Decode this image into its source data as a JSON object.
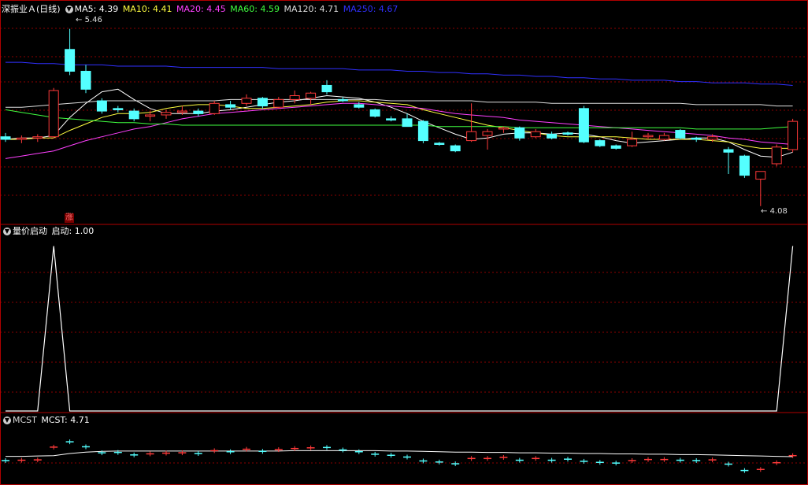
{
  "price_panel": {
    "name": "深振业Ａ(日线)",
    "ma": [
      {
        "label": "MA5: 4.39",
        "color": "#ffffff"
      },
      {
        "label": "MA10: 4.41",
        "color": "#ffff40"
      },
      {
        "label": "MA20: 4.45",
        "color": "#ff40ff"
      },
      {
        "label": "MA60: 4.59",
        "color": "#40ff40"
      },
      {
        "label": "MA120: 4.71",
        "color": "#dddddd"
      },
      {
        "label": "MA250: 4.67",
        "color": "#3030ff"
      }
    ],
    "high_label": "5.46",
    "low_label": "4.08",
    "zhang_label": "涨"
  },
  "indicator_panel": {
    "title": "量价启动",
    "value_label": "启动: 1.00"
  },
  "mcst_panel": {
    "title": "MCST",
    "value_label": "MCST: 4.71"
  },
  "colors": {
    "up": "#ff3a3a",
    "down": "#54ffff",
    "grid": "#8b0000",
    "border": "#b00000"
  },
  "chart_data": {
    "type": "candlestick",
    "ylim": [
      3.95,
      5.55
    ],
    "candles": [
      [
        4.62,
        4.65,
        4.58,
        4.6
      ],
      [
        4.6,
        4.63,
        4.57,
        4.61
      ],
      [
        4.61,
        4.64,
        4.58,
        4.62
      ],
      [
        4.62,
        5.0,
        4.61,
        4.98
      ],
      [
        5.3,
        5.46,
        5.1,
        5.13
      ],
      [
        5.13,
        5.18,
        4.96,
        4.99
      ],
      [
        4.9,
        4.92,
        4.8,
        4.82
      ],
      [
        4.84,
        4.86,
        4.81,
        4.83
      ],
      [
        4.82,
        4.84,
        4.74,
        4.76
      ],
      [
        4.78,
        4.82,
        4.74,
        4.79
      ],
      [
        4.79,
        4.83,
        4.76,
        4.81
      ],
      [
        4.81,
        4.86,
        4.79,
        4.82
      ],
      [
        4.82,
        4.84,
        4.78,
        4.8
      ],
      [
        4.8,
        4.9,
        4.79,
        4.88
      ],
      [
        4.87,
        4.9,
        4.83,
        4.85
      ],
      [
        4.88,
        4.95,
        4.86,
        4.92
      ],
      [
        4.92,
        4.93,
        4.84,
        4.86
      ],
      [
        4.85,
        4.93,
        4.84,
        4.91
      ],
      [
        4.91,
        4.98,
        4.88,
        4.94
      ],
      [
        4.92,
        4.97,
        4.87,
        4.96
      ],
      [
        5.02,
        5.06,
        4.95,
        4.97
      ],
      [
        4.91,
        4.93,
        4.89,
        4.9
      ],
      [
        4.87,
        4.89,
        4.84,
        4.85
      ],
      [
        4.83,
        4.84,
        4.77,
        4.78
      ],
      [
        4.76,
        4.78,
        4.74,
        4.75
      ],
      [
        4.76,
        4.8,
        4.74,
        4.7
      ],
      [
        4.74,
        4.75,
        4.57,
        4.59
      ],
      [
        4.57,
        4.58,
        4.55,
        4.56
      ],
      [
        4.55,
        4.56,
        4.5,
        4.51
      ],
      [
        4.59,
        4.88,
        4.58,
        4.66
      ],
      [
        4.63,
        4.68,
        4.52,
        4.66
      ],
      [
        4.68,
        4.7,
        4.65,
        4.69
      ],
      [
        4.69,
        4.7,
        4.59,
        4.61
      ],
      [
        4.62,
        4.68,
        4.61,
        4.66
      ],
      [
        4.64,
        4.66,
        4.6,
        4.61
      ],
      [
        4.65,
        4.66,
        4.63,
        4.64
      ],
      [
        4.84,
        4.86,
        4.57,
        4.58
      ],
      [
        4.59,
        4.6,
        4.54,
        4.55
      ],
      [
        4.55,
        4.56,
        4.52,
        4.53
      ],
      [
        4.55,
        4.66,
        4.54,
        4.6
      ],
      [
        4.62,
        4.65,
        4.6,
        4.63
      ],
      [
        4.6,
        4.65,
        4.59,
        4.63
      ],
      [
        4.67,
        4.68,
        4.6,
        4.61
      ],
      [
        4.61,
        4.62,
        4.58,
        4.6
      ],
      [
        4.6,
        4.64,
        4.58,
        4.62
      ],
      [
        4.52,
        4.54,
        4.33,
        4.5
      ],
      [
        4.47,
        4.48,
        4.3,
        4.32
      ],
      [
        4.29,
        4.35,
        4.08,
        4.35
      ],
      [
        4.41,
        4.56,
        4.39,
        4.54
      ],
      [
        4.52,
        4.76,
        4.5,
        4.74
      ]
    ],
    "ma_lines": {
      "MA5": [
        4.6,
        4.61,
        4.61,
        4.63,
        4.77,
        4.88,
        4.97,
        4.99,
        4.91,
        4.84,
        4.8,
        4.8,
        4.8,
        4.82,
        4.83,
        4.85,
        4.87,
        4.89,
        4.9,
        4.92,
        4.94,
        4.93,
        4.92,
        4.89,
        4.85,
        4.8,
        4.74,
        4.69,
        4.64,
        4.6,
        4.61,
        4.64,
        4.65,
        4.65,
        4.64,
        4.65,
        4.64,
        4.62,
        4.59,
        4.57,
        4.58,
        4.59,
        4.6,
        4.61,
        4.61,
        4.58,
        4.52,
        4.47,
        4.46,
        4.5
      ],
      "MA10": [
        4.6,
        4.6,
        4.61,
        4.61,
        4.67,
        4.72,
        4.77,
        4.8,
        4.8,
        4.81,
        4.84,
        4.86,
        4.87,
        4.87,
        4.86,
        4.84,
        4.84,
        4.85,
        4.86,
        4.87,
        4.89,
        4.9,
        4.9,
        4.89,
        4.88,
        4.87,
        4.83,
        4.8,
        4.77,
        4.74,
        4.71,
        4.69,
        4.67,
        4.65,
        4.63,
        4.62,
        4.62,
        4.62,
        4.62,
        4.61,
        4.6,
        4.6,
        4.6,
        4.6,
        4.59,
        4.58,
        4.55,
        4.53,
        4.53,
        4.53
      ],
      "MA20": [
        4.45,
        4.47,
        4.49,
        4.51,
        4.55,
        4.59,
        4.62,
        4.65,
        4.68,
        4.7,
        4.73,
        4.76,
        4.78,
        4.8,
        4.81,
        4.82,
        4.83,
        4.84,
        4.85,
        4.86,
        4.87,
        4.88,
        4.88,
        4.87,
        4.86,
        4.85,
        4.84,
        4.82,
        4.8,
        4.79,
        4.78,
        4.77,
        4.75,
        4.74,
        4.73,
        4.72,
        4.71,
        4.7,
        4.69,
        4.68,
        4.67,
        4.66,
        4.65,
        4.64,
        4.63,
        4.61,
        4.6,
        4.58,
        4.57,
        4.56
      ],
      "MA60": [
        4.83,
        4.81,
        4.79,
        4.77,
        4.76,
        4.75,
        4.74,
        4.73,
        4.73,
        4.72,
        4.72,
        4.71,
        4.71,
        4.71,
        4.71,
        4.71,
        4.71,
        4.71,
        4.71,
        4.71,
        4.71,
        4.71,
        4.71,
        4.71,
        4.71,
        4.71,
        4.71,
        4.7,
        4.7,
        4.7,
        4.7,
        4.7,
        4.69,
        4.69,
        4.69,
        4.69,
        4.69,
        4.69,
        4.69,
        4.69,
        4.69,
        4.69,
        4.69,
        4.68,
        4.68,
        4.68,
        4.68,
        4.68,
        4.69,
        4.7
      ],
      "MA120": [
        4.85,
        4.85,
        4.86,
        4.87,
        4.88,
        4.89,
        4.9,
        4.9,
        4.9,
        4.9,
        4.9,
        4.9,
        4.9,
        4.9,
        4.91,
        4.91,
        4.91,
        4.91,
        4.91,
        4.91,
        4.91,
        4.91,
        4.91,
        4.91,
        4.9,
        4.9,
        4.9,
        4.9,
        4.9,
        4.9,
        4.89,
        4.89,
        4.89,
        4.89,
        4.88,
        4.88,
        4.88,
        4.88,
        4.88,
        4.88,
        4.88,
        4.88,
        4.88,
        4.87,
        4.87,
        4.87,
        4.87,
        4.87,
        4.86,
        4.86
      ],
      "MA250": [
        5.2,
        5.2,
        5.19,
        5.19,
        5.18,
        5.18,
        5.18,
        5.17,
        5.17,
        5.17,
        5.17,
        5.16,
        5.16,
        5.16,
        5.16,
        5.16,
        5.16,
        5.15,
        5.15,
        5.15,
        5.15,
        5.15,
        5.14,
        5.14,
        5.14,
        5.13,
        5.13,
        5.12,
        5.12,
        5.11,
        5.11,
        5.1,
        5.1,
        5.09,
        5.09,
        5.08,
        5.08,
        5.07,
        5.07,
        5.06,
        5.06,
        5.06,
        5.05,
        5.05,
        5.04,
        5.04,
        5.04,
        5.03,
        5.03,
        5.02
      ]
    },
    "signal": {
      "ylim": [
        0,
        1.05
      ],
      "values": [
        0,
        0,
        0,
        1,
        0,
        0,
        0,
        0,
        0,
        0,
        0,
        0,
        0,
        0,
        0,
        0,
        0,
        0,
        0,
        0,
        0,
        0,
        0,
        0,
        0,
        0,
        0,
        0,
        0,
        0,
        0,
        0,
        0,
        0,
        0,
        0,
        0,
        0,
        0,
        0,
        0,
        0,
        0,
        0,
        0,
        0,
        0,
        0,
        0,
        1
      ]
    },
    "mcst": {
      "ylim": [
        4.0,
        5.6
      ],
      "values": [
        4.72,
        4.72,
        4.73,
        4.74,
        4.8,
        4.84,
        4.86,
        4.87,
        4.87,
        4.87,
        4.87,
        4.87,
        4.87,
        4.87,
        4.87,
        4.87,
        4.87,
        4.87,
        4.88,
        4.88,
        4.88,
        4.88,
        4.88,
        4.88,
        4.87,
        4.87,
        4.86,
        4.85,
        4.84,
        4.84,
        4.83,
        4.83,
        4.82,
        4.82,
        4.81,
        4.81,
        4.8,
        4.8,
        4.79,
        4.79,
        4.78,
        4.78,
        4.77,
        4.77,
        4.76,
        4.75,
        4.74,
        4.73,
        4.72,
        4.71
      ]
    }
  }
}
